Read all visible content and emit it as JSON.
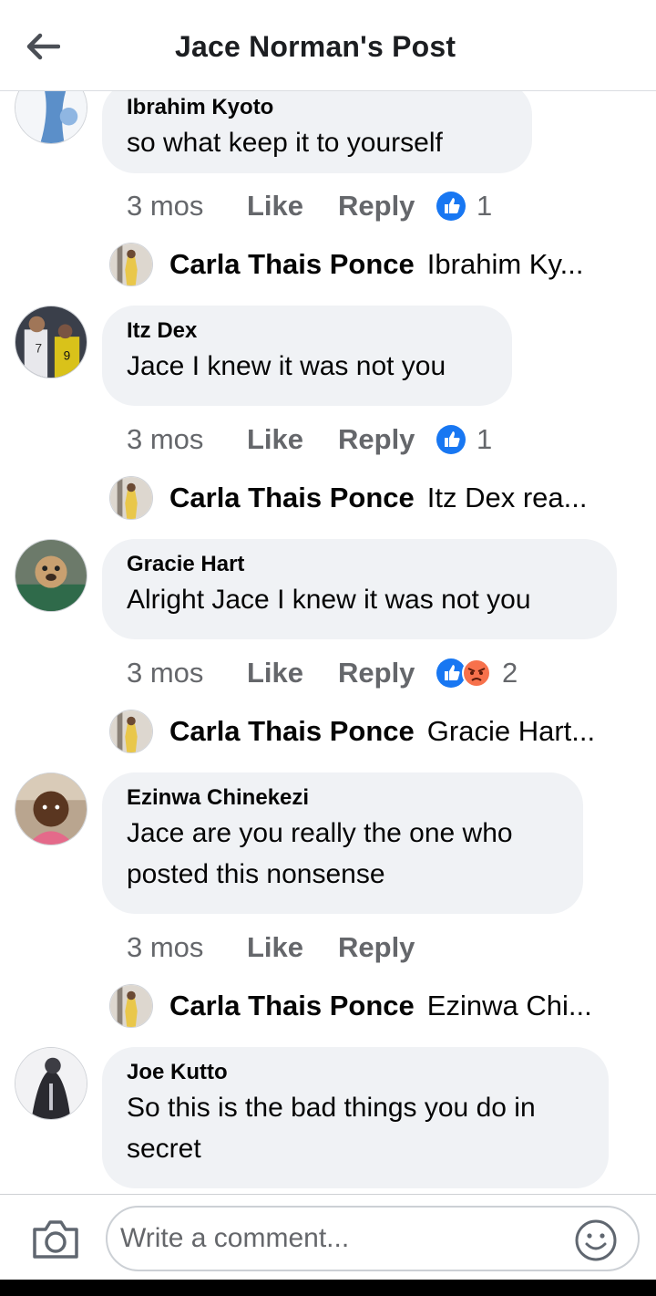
{
  "header": {
    "title": "Jace Norman's Post"
  },
  "comments": [
    {
      "author": "Ibrahim Kyoto",
      "text": "so  what  keep  it to yourself",
      "time": "3 mos",
      "like": "Like",
      "reply": "Reply",
      "reaction_count": "1",
      "reply_preview": {
        "name": "Carla Thais Ponce",
        "text": "Ibrahim Ky..."
      }
    },
    {
      "author": "Itz Dex",
      "text": "Jace I knew it was not you",
      "time": "3 mos",
      "like": "Like",
      "reply": "Reply",
      "reaction_count": "1",
      "reply_preview": {
        "name": "Carla Thais Ponce",
        "text": "Itz Dex rea..."
      }
    },
    {
      "author": "Gracie Hart",
      "text": "Alright Jace I knew it was not you",
      "time": "3 mos",
      "like": "Like",
      "reply": "Reply",
      "reaction_count": "2",
      "reply_preview": {
        "name": "Carla Thais Ponce",
        "text": "Gracie Hart..."
      }
    },
    {
      "author": "Ezinwa Chinekezi",
      "text": "Jace are you really the one who",
      "text2": "posted this nonsense",
      "time": "3 mos",
      "like": "Like",
      "reply": "Reply",
      "reply_preview": {
        "name": "Carla Thais Ponce",
        "text": "Ezinwa Chi..."
      }
    },
    {
      "author": "Joe Kutto",
      "text": "So this is the bad things you do in",
      "text2": "secret"
    }
  ],
  "composer": {
    "placeholder": "Write a comment..."
  },
  "icons": {
    "back": "back-arrow-icon",
    "like_reaction": "like-reaction-icon",
    "angry_reaction": "angry-reaction-icon",
    "camera": "camera-icon",
    "emoji": "emoji-icon"
  },
  "colors": {
    "like_blue": "#1877f2",
    "angry_orange": "#f7714c",
    "bubble_bg": "#f0f2f5",
    "meta_gray": "#65676b"
  }
}
